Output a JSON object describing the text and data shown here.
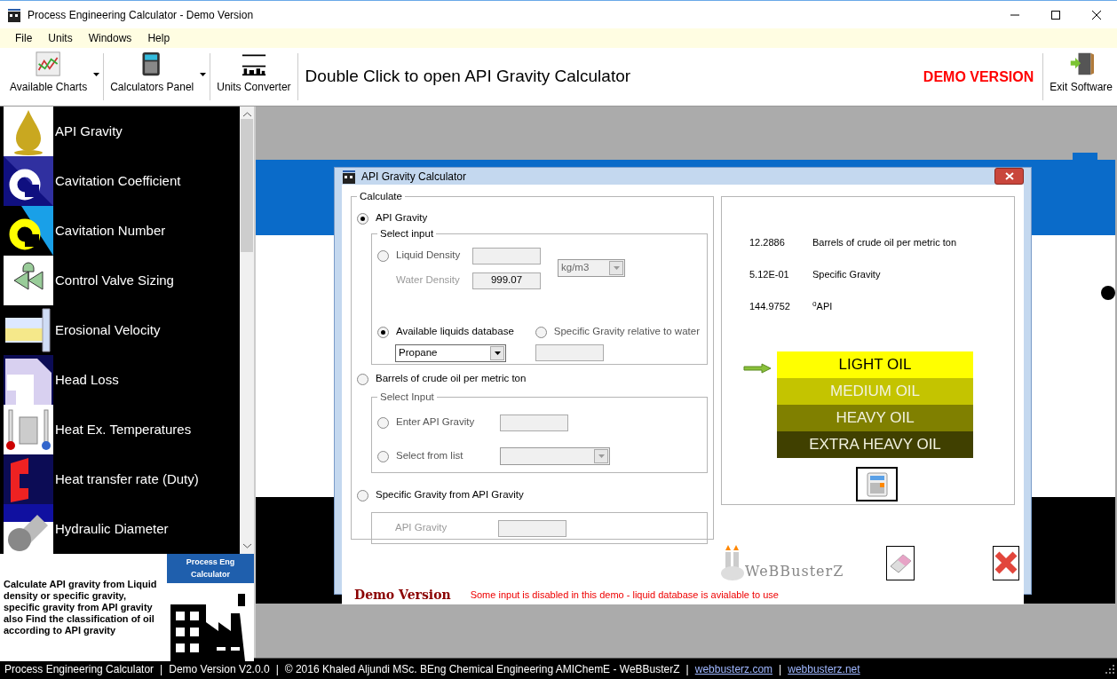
{
  "window": {
    "title": "Process Engineering Calculator - Demo Version"
  },
  "menu": [
    "File",
    "Units",
    "Windows",
    "Help"
  ],
  "toolbar": {
    "buttons": [
      {
        "label": "Available Charts",
        "kind": "chart",
        "dropdown": true
      },
      {
        "label": "Calculators Panel",
        "kind": "calculator",
        "dropdown": true
      },
      {
        "label": "Units Converter",
        "kind": "units",
        "dropdown": false
      }
    ],
    "hint": "Double Click to open API Gravity Calculator",
    "demo_badge": "DEMO VERSION",
    "exit_button": "Exit Software"
  },
  "sidebar": {
    "items": [
      {
        "label": "API Gravity"
      },
      {
        "label": "Cavitation Coefficient"
      },
      {
        "label": "Cavitation Number"
      },
      {
        "label": "Control Valve Sizing"
      },
      {
        "label": "Erosional Velocity"
      },
      {
        "label": "Head Loss"
      },
      {
        "label": "Heat Ex. Temperatures"
      },
      {
        "label": "Heat transfer rate (Duty)"
      },
      {
        "label": "Hydraulic Diameter"
      }
    ],
    "description": "Calculate API gravity from Liquid density or specific gravity, specific gravity from API gravity also Find the classification of oil according to API gravity",
    "logo_caption": "Process Eng Calculator"
  },
  "dialog": {
    "title": "API Gravity Calculator",
    "calculate": {
      "legend": "Calculate",
      "api_gravity": {
        "label": "API Gravity",
        "selected": true,
        "legend": "Select input",
        "liquid_density": {
          "label": "Liquid Density",
          "selected": false
        },
        "water_density": {
          "label": "Water Density",
          "value": "999.07",
          "disabled": true
        },
        "unit": {
          "value": "kg/m3"
        },
        "database": {
          "label": "Available liquids database",
          "selected": true,
          "value": "Propane"
        },
        "specific_gravity": {
          "label": "Specific Gravity relative to water",
          "selected": false
        }
      },
      "barrels": {
        "label": "Barrels of crude oil per metric ton",
        "selected": false,
        "legend": "Select Input",
        "enter_api": {
          "label": "Enter API Gravity",
          "selected": false
        },
        "from_list": {
          "label": "Select from list",
          "selected": false
        }
      },
      "sg_from_api": {
        "label": "Specific Gravity from API Gravity",
        "selected": false,
        "field_label": "API Gravity",
        "disabled": true
      }
    },
    "results": [
      {
        "value": "12.2886",
        "label": "Barrels of crude oil per metric ton"
      },
      {
        "value": "5.12E-01",
        "label": "Specific Gravity"
      },
      {
        "value": "144.9752",
        "label": "$^{o}$API"
      }
    ],
    "oil_classes": [
      {
        "label": "LIGHT OIL",
        "color": "#ffff00",
        "selected": true
      },
      {
        "label": "MEDIUM OIL",
        "color": "#c4c400",
        "selected": false
      },
      {
        "label": "HEAVY OIL",
        "color": "#808000",
        "selected": false
      },
      {
        "label": "EXTRA HEAVY OIL",
        "color": "#404000",
        "selected": false
      }
    ],
    "logo": "WeBBusterZ",
    "demo_label": "Demo Version",
    "demo_note": "Some input is disabled in this demo - liquid database is avialable to use"
  },
  "status_bar": [
    {
      "text": "Process Engineering Calculator",
      "kind": "text"
    },
    {
      "text": "|",
      "kind": "separator"
    },
    {
      "text": "Demo Version V2.0.0",
      "kind": "text"
    },
    {
      "text": "|",
      "kind": "separator"
    },
    {
      "text": "© 2016 Khaled Aljundi MSc. BEng Chemical Engineering AMIChemE - WeBBusterZ",
      "kind": "text"
    },
    {
      "text": "|",
      "kind": "separator"
    },
    {
      "text": "webbusterz.com",
      "kind": "link"
    },
    {
      "text": "|",
      "kind": "separator"
    },
    {
      "text": "webbusterz.net",
      "kind": "link"
    }
  ]
}
